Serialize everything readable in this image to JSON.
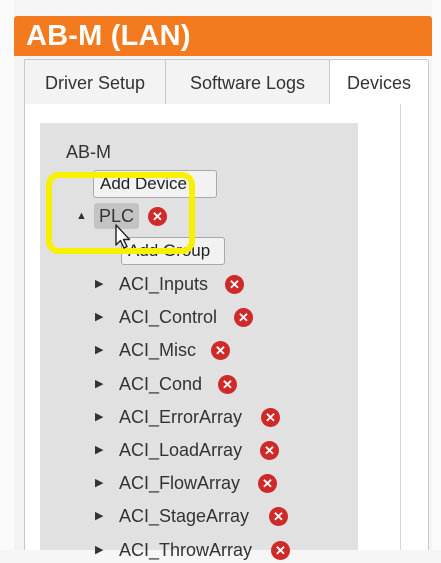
{
  "app": {
    "title": "AB-M (LAN)"
  },
  "tabs": [
    {
      "label": "Driver Setup",
      "active": false
    },
    {
      "label": "Software Logs",
      "active": false
    },
    {
      "label": "Devices",
      "active": true
    }
  ],
  "tree": {
    "root_label": "AB-M",
    "add_device_label": "Add Device",
    "device": {
      "label": "PLC",
      "expanded": true,
      "remove_icon": "remove-icon",
      "add_group_label": "Add Group",
      "groups": [
        {
          "label": "ACI_Inputs"
        },
        {
          "label": "ACI_Control"
        },
        {
          "label": "ACI_Misc"
        },
        {
          "label": "ACI_Cond"
        },
        {
          "label": "ACI_ErrorArray"
        },
        {
          "label": "ACI_LoadArray"
        },
        {
          "label": "ACI_FlowArray"
        },
        {
          "label": "ACI_StageArray"
        },
        {
          "label": "ACI_ThrowArray"
        }
      ]
    }
  },
  "colors": {
    "title_bar": "#f47a20",
    "highlight": "#f7f100",
    "remove_icon": "#cf2a2a"
  },
  "icons": {
    "collapse_arrow": "triangle-down",
    "expand_arrow": "triangle-right",
    "remove": "x-circle",
    "cursor": "pointer-cursor"
  }
}
